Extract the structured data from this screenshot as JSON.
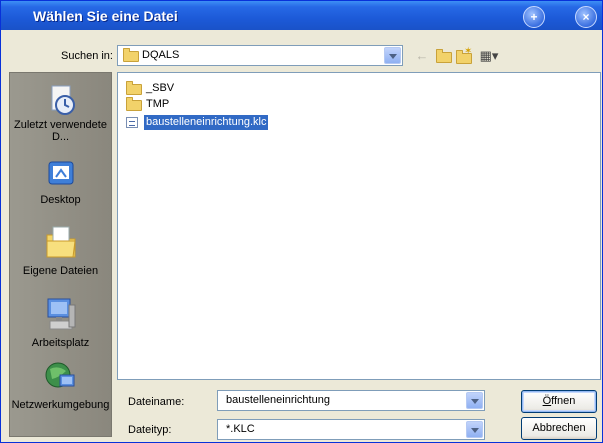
{
  "window": {
    "title": "Wählen Sie eine Datei",
    "help_icon": "help-icon",
    "close_icon": "close-icon"
  },
  "lookin": {
    "label": "Suchen in:",
    "value": "DQALS",
    "icon": "folder-icon"
  },
  "toolbar": {
    "icons": [
      "back-icon",
      "up-folder-icon",
      "new-folder-icon",
      "view-menu-icon"
    ]
  },
  "places": [
    {
      "label": "Zuletzt verwendete D...",
      "icon": "recent-documents-icon"
    },
    {
      "label": "Desktop",
      "icon": "desktop-icon"
    },
    {
      "label": "Eigene Dateien",
      "icon": "my-documents-icon"
    },
    {
      "label": "Arbeitsplatz",
      "icon": "my-computer-icon"
    },
    {
      "label": "Netzwerkumgebung",
      "icon": "network-icon"
    }
  ],
  "files": [
    {
      "name": "_SBV",
      "type": "folder",
      "selected": false
    },
    {
      "name": "TMP",
      "type": "folder",
      "selected": false
    },
    {
      "name": "baustelleneinrichtung.klc",
      "type": "file",
      "selected": true
    }
  ],
  "filename": {
    "label": "Dateiname:",
    "value": "baustelleneinrichtung"
  },
  "filetype": {
    "label": "Dateityp:",
    "value": "*.KLC"
  },
  "buttons": {
    "open": "Öffnen",
    "open_underline": "Ö",
    "open_rest": "ffnen",
    "cancel": "Abbrechen"
  },
  "colors": {
    "titlebar": "#1c5ad8",
    "selection": "#316ac5",
    "dialog_bg": "#ece9d8",
    "places_bar": "#8c8a83"
  }
}
